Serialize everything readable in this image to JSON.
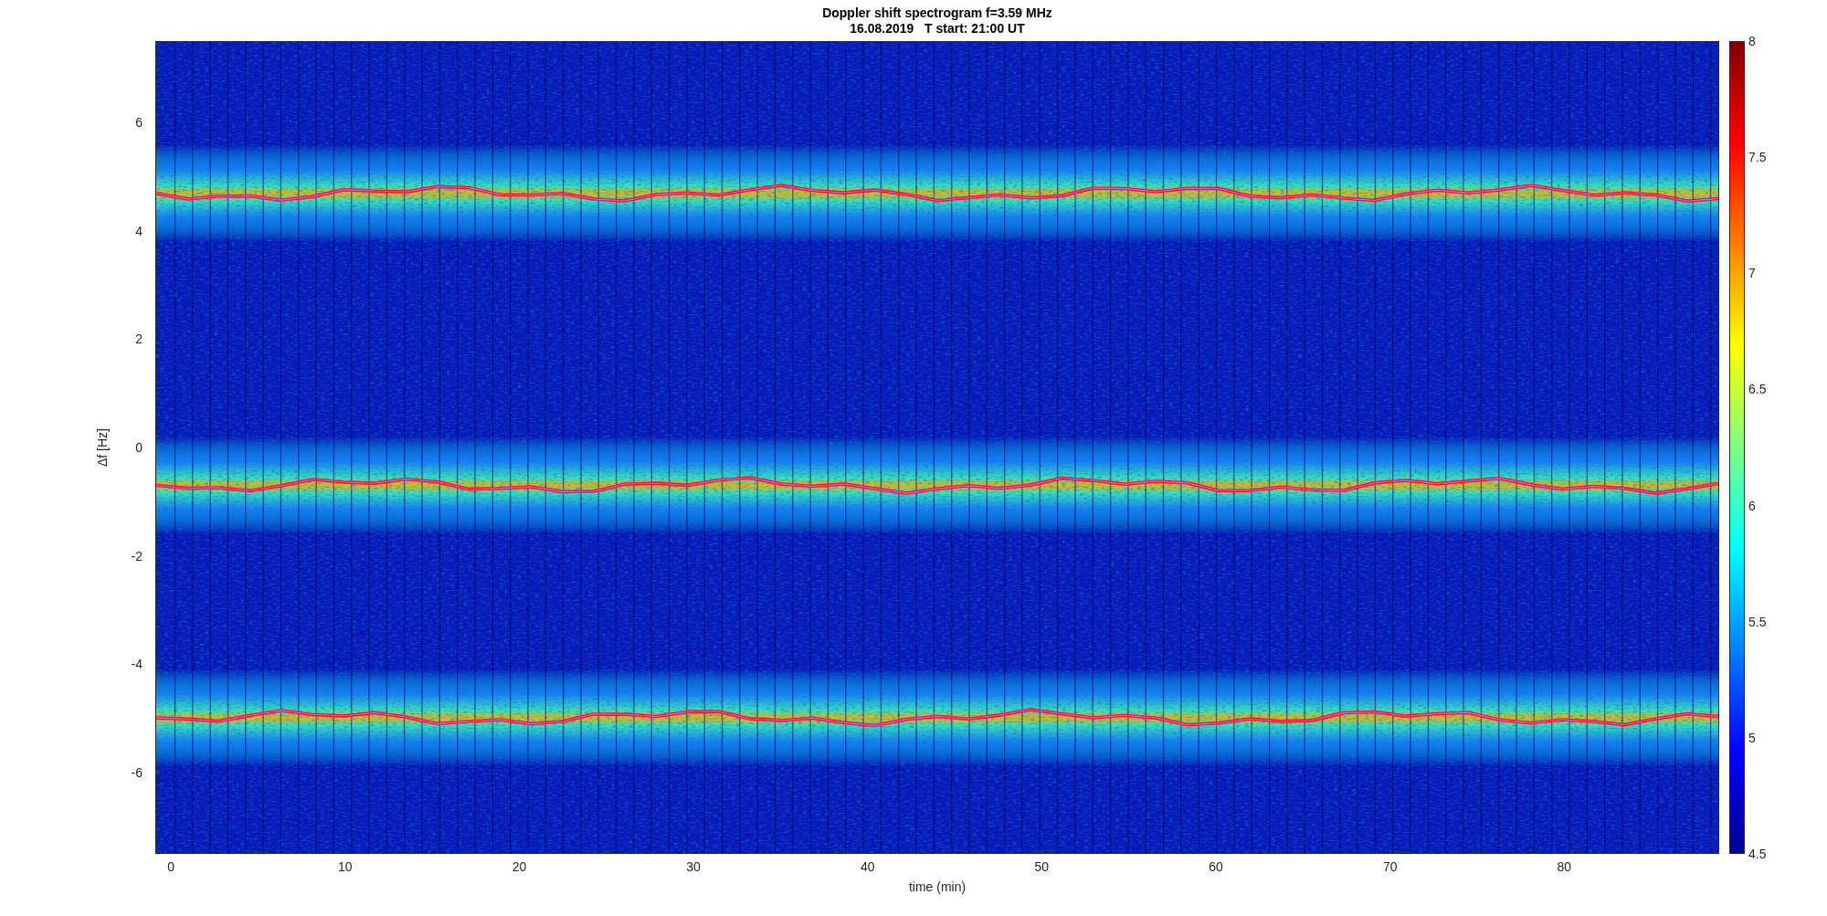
{
  "figure": {
    "title": "Doppler shift spectrogram f=3.59 MHz",
    "subtitle": "16.08.2019   T start: 21:00 UT"
  },
  "axes": {
    "ylabel": "Δf [Hz]",
    "xlabel": "time (min)",
    "yticks": [
      "6",
      "4",
      "2",
      "0",
      "-2",
      "-4",
      "-6"
    ],
    "xticks": [
      "0",
      "10",
      "20",
      "30",
      "40",
      "50",
      "60",
      "70",
      "80"
    ]
  },
  "colorbar": {
    "ticks": [
      "8",
      "7.5",
      "7",
      "6.5",
      "6",
      "5.5",
      "5",
      "4.5"
    ]
  }
}
